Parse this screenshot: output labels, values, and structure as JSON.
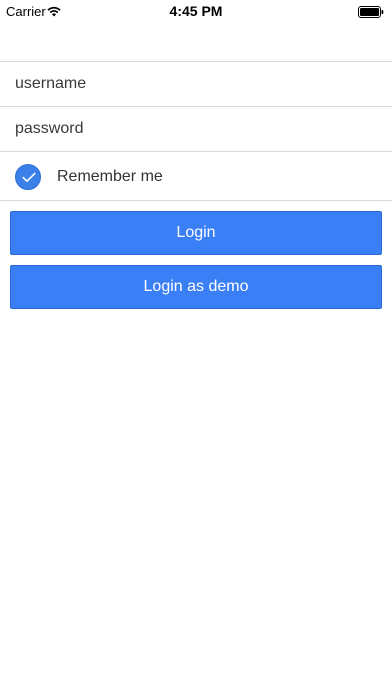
{
  "status_bar": {
    "carrier": "Carrier",
    "time": "4:45 PM",
    "wifi_icon": "wifi-icon",
    "battery_icon": "battery-icon"
  },
  "form": {
    "username_placeholder": "username",
    "username_value": "",
    "password_placeholder": "password",
    "password_value": "",
    "remember_label": "Remember me",
    "remember_checked": true,
    "check_icon": "checkmark-icon"
  },
  "buttons": {
    "login_label": "Login",
    "demo_label": "Login as demo"
  },
  "colors": {
    "accent": "#3b7ff6",
    "divider": "#dadada"
  }
}
